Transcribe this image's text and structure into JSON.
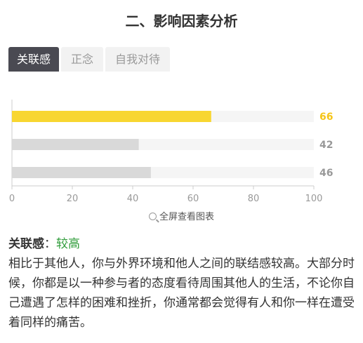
{
  "section": {
    "title": "二、影响因素分析"
  },
  "tabs": [
    {
      "label": "关联感",
      "active": true
    },
    {
      "label": "正念",
      "active": false
    },
    {
      "label": "自我对待",
      "active": false
    }
  ],
  "chart_data": {
    "type": "bar",
    "orientation": "horizontal",
    "categories": [
      "关联感",
      "正念",
      "自我对待"
    ],
    "values": [
      66,
      42,
      46
    ],
    "xlim": [
      0,
      100
    ],
    "xticks": [
      0,
      20,
      40,
      60,
      80,
      100
    ],
    "grid": false,
    "colors": {
      "highlight": "#f8d631",
      "normal": "#d9d9d9",
      "track": "#f5f5f5",
      "highlight_label": "#f5c518",
      "label": "#999999"
    }
  },
  "fullscreen_label": "全屏查看图表",
  "result": {
    "label": "关联感",
    "separator": "：",
    "level": "较高",
    "description": "相比于其他人，你与外界环境和他人之间的联结感较高。大部分时候，你都是以一种参与者的态度看待周围其他人的生活，不论你自己遭遇了怎样的困难和挫折，你通常都会觉得有人和你一样在遭受着同样的痛苦。"
  }
}
